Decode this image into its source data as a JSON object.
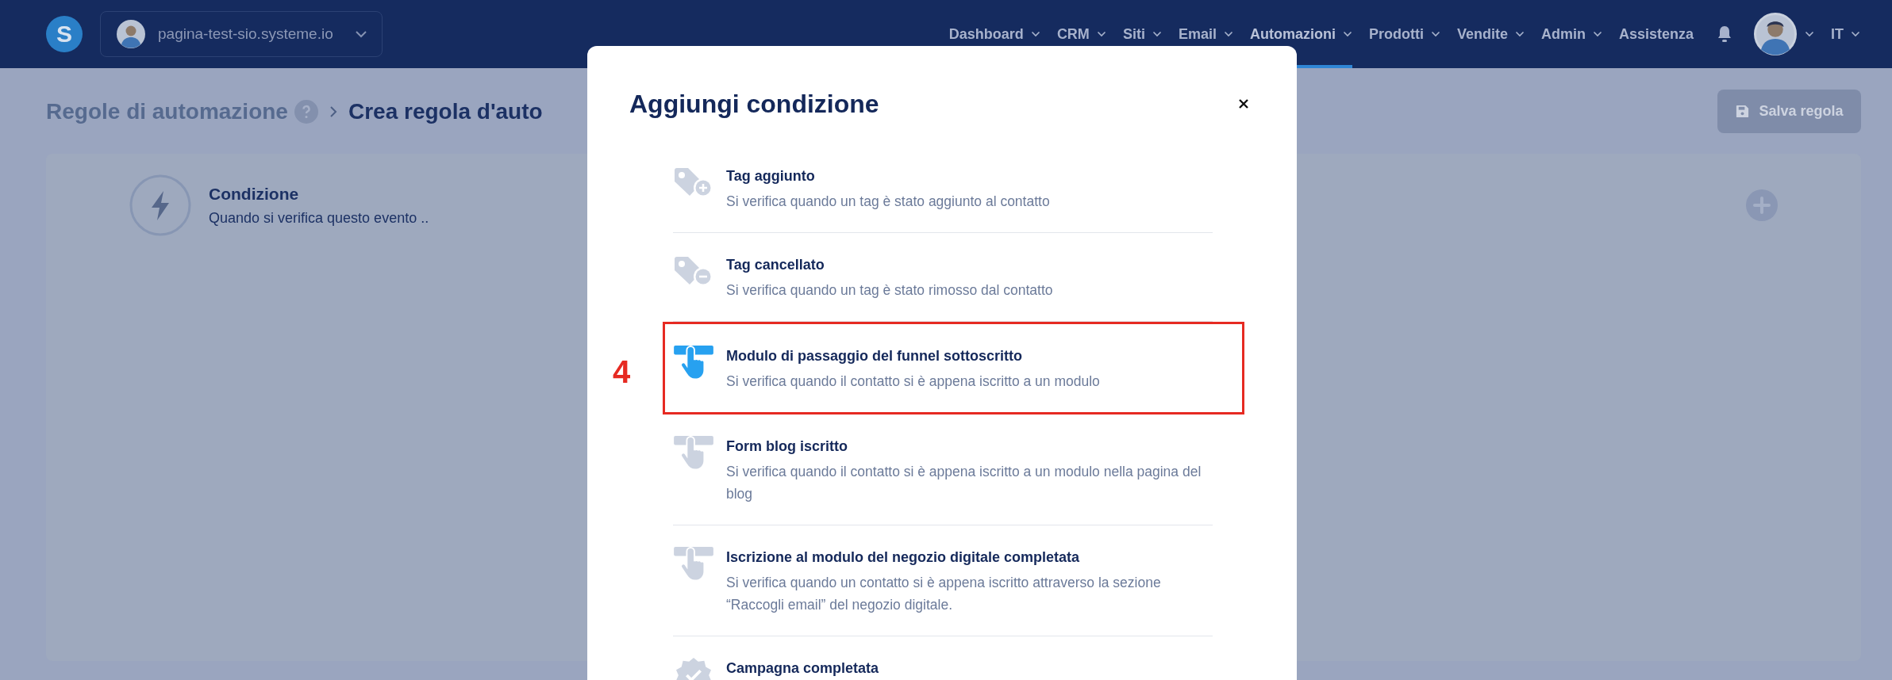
{
  "top_bar": {
    "logo": "S",
    "site_selector": {
      "label": "pagina-test-sio.systeme.io"
    },
    "nav": [
      {
        "label": "Dashboard",
        "dropdown": true,
        "selected": false
      },
      {
        "label": "CRM",
        "dropdown": true,
        "selected": false
      },
      {
        "label": "Siti",
        "dropdown": true,
        "selected": false
      },
      {
        "label": "Email",
        "dropdown": true,
        "selected": false
      },
      {
        "label": "Automazioni",
        "dropdown": true,
        "selected": true
      },
      {
        "label": "Prodotti",
        "dropdown": true,
        "selected": false
      },
      {
        "label": "Vendite",
        "dropdown": true,
        "selected": false
      },
      {
        "label": "Admin",
        "dropdown": true,
        "selected": false
      },
      {
        "label": "Assistenza",
        "dropdown": false,
        "selected": false
      }
    ],
    "language": "IT"
  },
  "breadcrumb": [
    {
      "label": "Regole di automazione",
      "help": true
    },
    {
      "label": "Crea regola d'auto"
    }
  ],
  "save_button": {
    "label": "Salva regola",
    "disabled": true
  },
  "trigger_card": {
    "title": "Condizione",
    "subtitle": "Quando si verifica questo evento .."
  },
  "modal": {
    "title": "Aggiungi condizione",
    "options": [
      {
        "kind": "tag-add",
        "title": "Tag aggiunto",
        "description": "Si verifica quando un tag è stato aggiunto al contatto",
        "highlighted": false
      },
      {
        "kind": "tag-remove",
        "title": "Tag cancellato",
        "description": "Si verifica quando un tag è stato rimosso dal contatto",
        "highlighted": false
      },
      {
        "kind": "form",
        "title": "Modulo di passaggio del funnel sottoscritto",
        "description": "Si verifica quando il contatto si è appena iscritto a un modulo",
        "highlighted": true,
        "annotation": "4"
      },
      {
        "kind": "form",
        "title": "Form blog iscritto",
        "description": "Si verifica quando il contatto si è appena iscritto a un modulo nella pagina del blog",
        "highlighted": false
      },
      {
        "kind": "form",
        "title": "Iscrizione al modulo del negozio digitale completata",
        "description": "Si verifica quando un contatto si è appena iscritto attraverso la sezione “Raccogli email” del negozio digitale.",
        "highlighted": false
      },
      {
        "kind": "badge",
        "title": "Campagna completata",
        "highlighted": false
      }
    ]
  }
}
